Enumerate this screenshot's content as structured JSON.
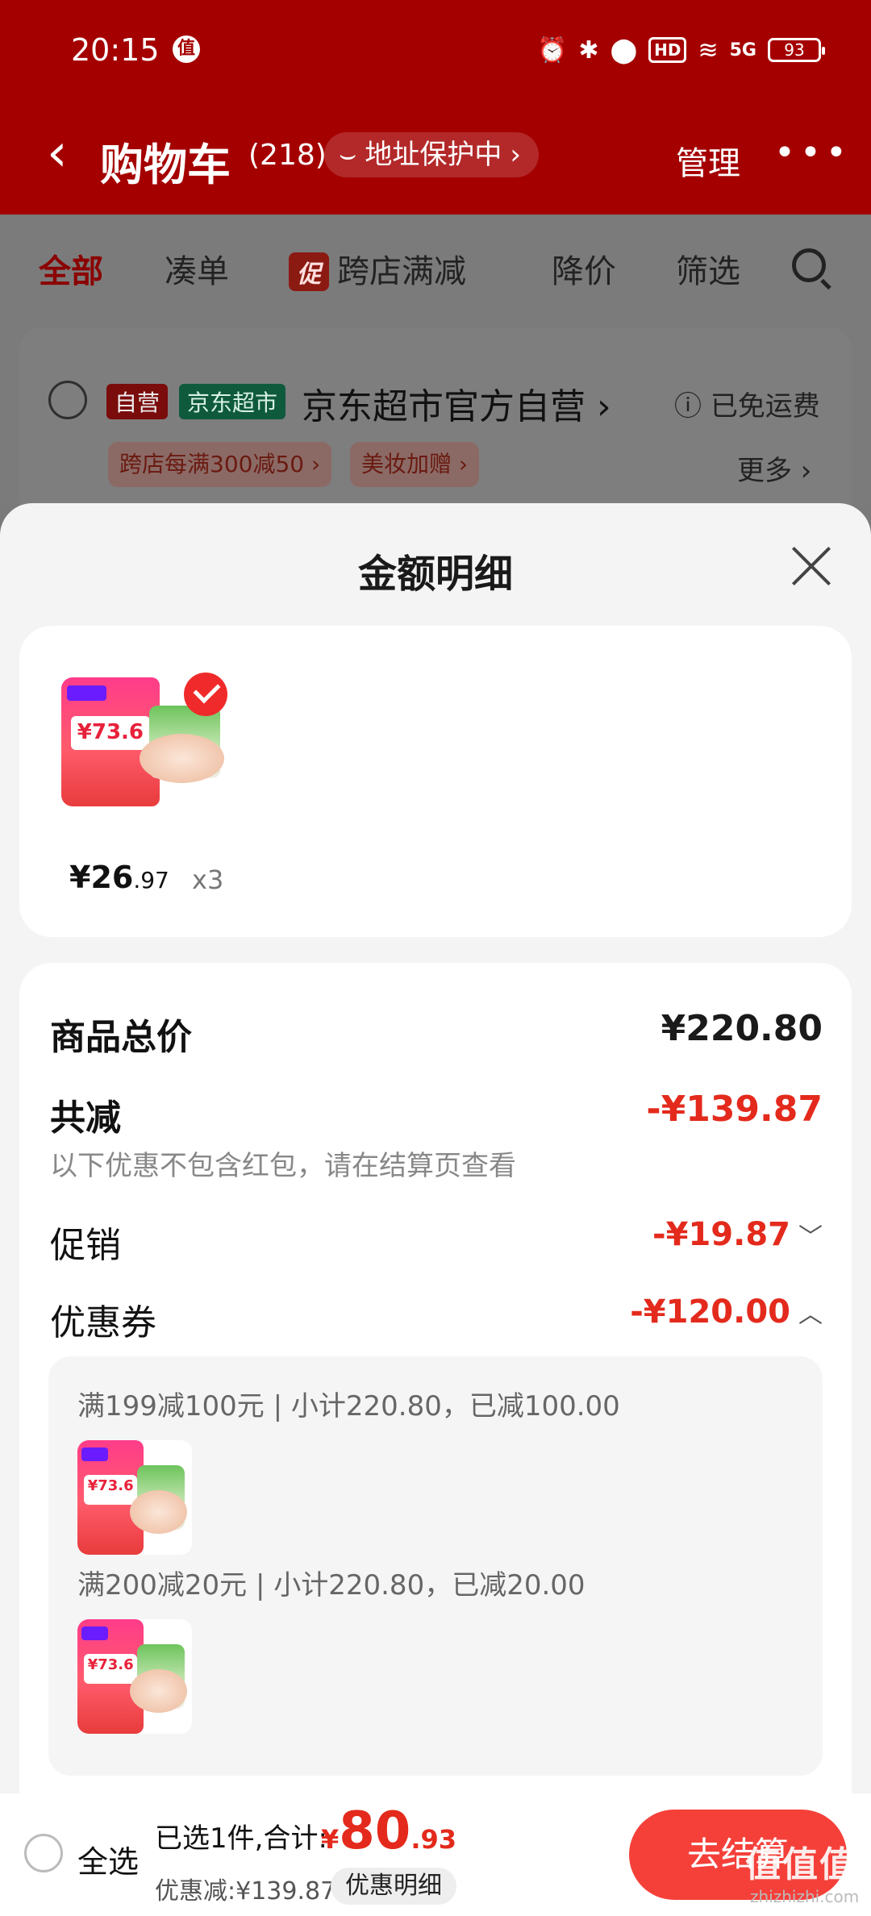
{
  "status_bar": {
    "time": "20:15",
    "zhi_badge": "值",
    "network": "5G",
    "hd": "HD",
    "battery": "93"
  },
  "nav": {
    "back_icon": "‹",
    "title": "购物车",
    "count": "(218)",
    "address_protect": "地址保护中",
    "manage": "管理",
    "more": "•••"
  },
  "filters": {
    "all": "全部",
    "combine": "凑单",
    "promo_badge": "促",
    "cross_store": "跨店满减",
    "price_drop": "降价",
    "filter": "筛选"
  },
  "store": {
    "tag_self": "自营",
    "tag_jd": "京东超市",
    "name": "京东超市官方自营",
    "shipping": "已免运费",
    "promo1": "跨店每满300减50",
    "promo2": "美妆加赠",
    "more": "更多"
  },
  "sheet": {
    "title": "金额明细",
    "product": {
      "thumb_price": "¥73.6",
      "price_int": "¥26",
      "price_dec": ".97",
      "qty": "x3"
    },
    "total_label": "商品总价",
    "total_value": "¥220.80",
    "reduce_label": "共减",
    "reduce_value": "-¥139.87",
    "hint": "以下优惠不包含红包，请在结算页查看",
    "promo_label": "促销",
    "promo_value": "-¥19.87",
    "coupon_label": "优惠券",
    "coupon_value": "-¥120.00",
    "coupons": [
      {
        "text": "满199减100元 | 小计220.80，已减100.00"
      },
      {
        "text": "满200减20元 | 小计220.80，已减20.00"
      }
    ]
  },
  "bottom": {
    "select_all": "全选",
    "selected": "已选1件,合计:",
    "total_yen": "¥",
    "total_int": "80",
    "total_dec": ".93",
    "discount": "优惠减:¥139.87",
    "detail_button": "优惠明细",
    "checkout": "去结算"
  },
  "watermark": {
    "main": "值值值",
    "sub": "zhizhizhi.com"
  },
  "colors": {
    "header_red": "#a50000",
    "accent_red": "#e32a1c",
    "checkout_red": "#f5403a"
  }
}
